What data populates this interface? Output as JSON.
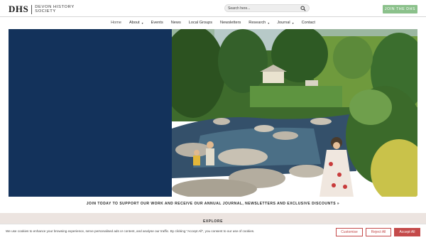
{
  "header": {
    "logo_mark": "DHS",
    "logo_line1": "Devon History",
    "logo_line2": "Society",
    "search_placeholder": "Search here...",
    "join_label": "JOIN THE DHS"
  },
  "nav": {
    "items": [
      {
        "label": "Home",
        "has_caret": false
      },
      {
        "label": "About",
        "has_caret": true
      },
      {
        "label": "Events",
        "has_caret": false
      },
      {
        "label": "News",
        "has_caret": false
      },
      {
        "label": "Local Groups",
        "has_caret": false
      },
      {
        "label": "Newsletters",
        "has_caret": false
      },
      {
        "label": "Research",
        "has_caret": true
      },
      {
        "label": "Journal",
        "has_caret": true
      },
      {
        "label": "Contact",
        "has_caret": false
      }
    ],
    "caret": "▾"
  },
  "hero": {
    "panel_color": "#13325b"
  },
  "cta": {
    "text": "JOIN TODAY TO SUPPORT OUR WORK AND RECEIVE OUR ANNUAL JOURNAL, NEWSLETTERS AND EXCLUSIVE DISCOUNTS »"
  },
  "explore": {
    "label": "EXPLORE"
  },
  "cookie": {
    "text": "We use cookies to enhance your browsing experience, serve personalised ads or content, and analyse our traffic. By clicking \"Accept All\", you consent to our use of cookies.",
    "customize_label": "Customise",
    "reject_label": "Reject All",
    "accept_label": "Accept All"
  },
  "colors": {
    "accent_green": "#8bc18b",
    "cookie_red": "#c44a4a",
    "explore_bg": "#ece4e0"
  }
}
